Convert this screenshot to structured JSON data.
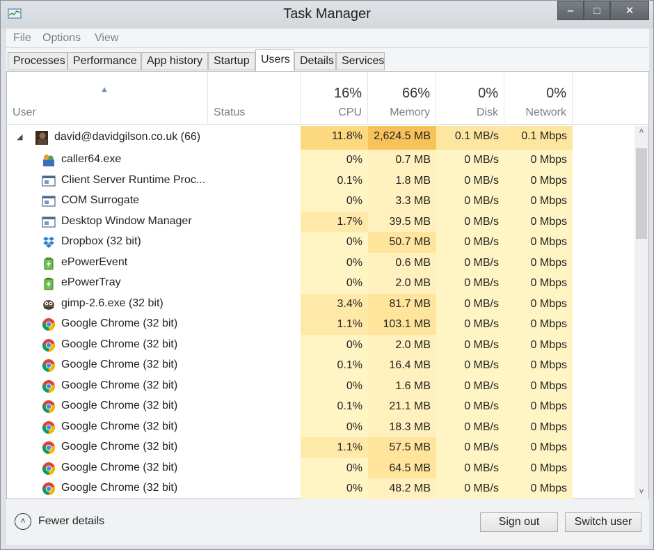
{
  "window": {
    "title": "Task Manager"
  },
  "menu": [
    "File",
    "Options",
    "View"
  ],
  "tabs": [
    "Processes",
    "Performance",
    "App history",
    "Startup",
    "Users",
    "Details",
    "Services"
  ],
  "header": {
    "user": "User",
    "status": "Status",
    "cpu": {
      "pct": "16%",
      "label": "CPU"
    },
    "memory": {
      "pct": "66%",
      "label": "Memory"
    },
    "disk": {
      "pct": "0%",
      "label": "Disk"
    },
    "network": {
      "pct": "0%",
      "label": "Network"
    }
  },
  "user_row": {
    "name": "david@davidgilson.co.uk (66)",
    "cpu": "11.8%",
    "memory": "2,624.5 MB",
    "disk": "0.1 MB/s",
    "network": "0.1 Mbps"
  },
  "processes": [
    {
      "icon": "caller-icon",
      "name": "caller64.exe",
      "cpu": "0%",
      "memory": "0.7 MB",
      "disk": "0 MB/s",
      "network": "0 Mbps"
    },
    {
      "icon": "window-process-icon",
      "name": "Client Server Runtime Proc...",
      "cpu": "0.1%",
      "memory": "1.8 MB",
      "disk": "0 MB/s",
      "network": "0 Mbps"
    },
    {
      "icon": "window-process-icon",
      "name": "COM Surrogate",
      "cpu": "0%",
      "memory": "3.3 MB",
      "disk": "0 MB/s",
      "network": "0 Mbps"
    },
    {
      "icon": "window-process-icon",
      "name": "Desktop Window Manager",
      "cpu": "1.7%",
      "memory": "39.5 MB",
      "disk": "0 MB/s",
      "network": "0 Mbps"
    },
    {
      "icon": "dropbox-icon",
      "name": "Dropbox (32 bit)",
      "cpu": "0%",
      "memory": "50.7 MB",
      "disk": "0 MB/s",
      "network": "0 Mbps"
    },
    {
      "icon": "battery-icon",
      "name": "ePowerEvent",
      "cpu": "0%",
      "memory": "0.6 MB",
      "disk": "0 MB/s",
      "network": "0 Mbps"
    },
    {
      "icon": "battery-icon",
      "name": "ePowerTray",
      "cpu": "0%",
      "memory": "2.0 MB",
      "disk": "0 MB/s",
      "network": "0 Mbps"
    },
    {
      "icon": "gimp-icon",
      "name": "gimp-2.6.exe (32 bit)",
      "cpu": "3.4%",
      "memory": "81.7 MB",
      "disk": "0 MB/s",
      "network": "0 Mbps"
    },
    {
      "icon": "chrome-icon",
      "name": "Google Chrome (32 bit)",
      "cpu": "1.1%",
      "memory": "103.1 MB",
      "disk": "0 MB/s",
      "network": "0 Mbps"
    },
    {
      "icon": "chrome-icon",
      "name": "Google Chrome (32 bit)",
      "cpu": "0%",
      "memory": "2.0 MB",
      "disk": "0 MB/s",
      "network": "0 Mbps"
    },
    {
      "icon": "chrome-icon",
      "name": "Google Chrome (32 bit)",
      "cpu": "0.1%",
      "memory": "16.4 MB",
      "disk": "0 MB/s",
      "network": "0 Mbps"
    },
    {
      "icon": "chrome-icon",
      "name": "Google Chrome (32 bit)",
      "cpu": "0%",
      "memory": "1.6 MB",
      "disk": "0 MB/s",
      "network": "0 Mbps"
    },
    {
      "icon": "chrome-icon",
      "name": "Google Chrome (32 bit)",
      "cpu": "0.1%",
      "memory": "21.1 MB",
      "disk": "0 MB/s",
      "network": "0 Mbps"
    },
    {
      "icon": "chrome-icon",
      "name": "Google Chrome (32 bit)",
      "cpu": "0%",
      "memory": "18.3 MB",
      "disk": "0 MB/s",
      "network": "0 Mbps"
    },
    {
      "icon": "chrome-icon",
      "name": "Google Chrome (32 bit)",
      "cpu": "1.1%",
      "memory": "57.5 MB",
      "disk": "0 MB/s",
      "network": "0 Mbps"
    },
    {
      "icon": "chrome-icon",
      "name": "Google Chrome (32 bit)",
      "cpu": "0%",
      "memory": "64.5 MB",
      "disk": "0 MB/s",
      "network": "0 Mbps"
    },
    {
      "icon": "chrome-icon",
      "name": "Google Chrome (32 bit)",
      "cpu": "0%",
      "memory": "48.2 MB",
      "disk": "0 MB/s",
      "network": "0 Mbps"
    }
  ],
  "footer": {
    "fewer_details": "Fewer details",
    "sign_out": "Sign out",
    "switch_user": "Switch user"
  },
  "colors": {
    "heat_light": "#fff4c4",
    "heat_mid": "#ffe9a8",
    "heat_user": "#fcd87e",
    "heat_user_mem": "#f8c25a"
  }
}
